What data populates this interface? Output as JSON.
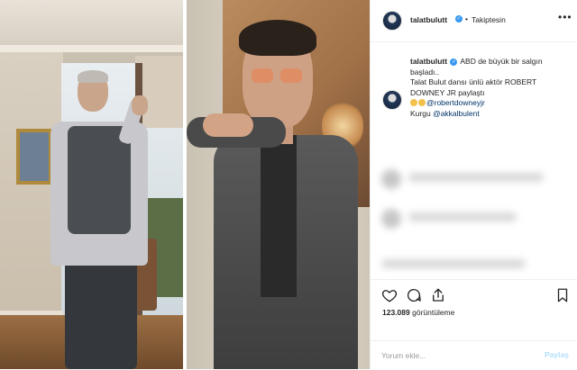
{
  "header": {
    "username": "talatbulutt",
    "separator": "•",
    "follow_status": "Takiptesin",
    "more_icon": "more-horizontal-icon"
  },
  "caption": {
    "username": "talatbulutt",
    "line1": "ABD de büyük bir salgın başladı..",
    "line2": "Talat Bulut dansı ünlü aktör ROBERT DOWNEY JR paylaştı",
    "mention1": "@robertdowneyjr",
    "credit_label": "Kurgu",
    "mention2": "@akkalbulent"
  },
  "actions": {
    "like_icon": "heart-icon",
    "comment_icon": "comment-icon",
    "share_icon": "share-icon",
    "save_icon": "bookmark-icon"
  },
  "views": {
    "count": "123.089",
    "label": "görüntüleme"
  },
  "comment_box": {
    "placeholder": "Yorum ekle...",
    "post_label": "Paylaş"
  },
  "colors": {
    "accent_blue": "#3897f0",
    "link_blue": "#003569",
    "post_disabled": "#b2dffc"
  }
}
